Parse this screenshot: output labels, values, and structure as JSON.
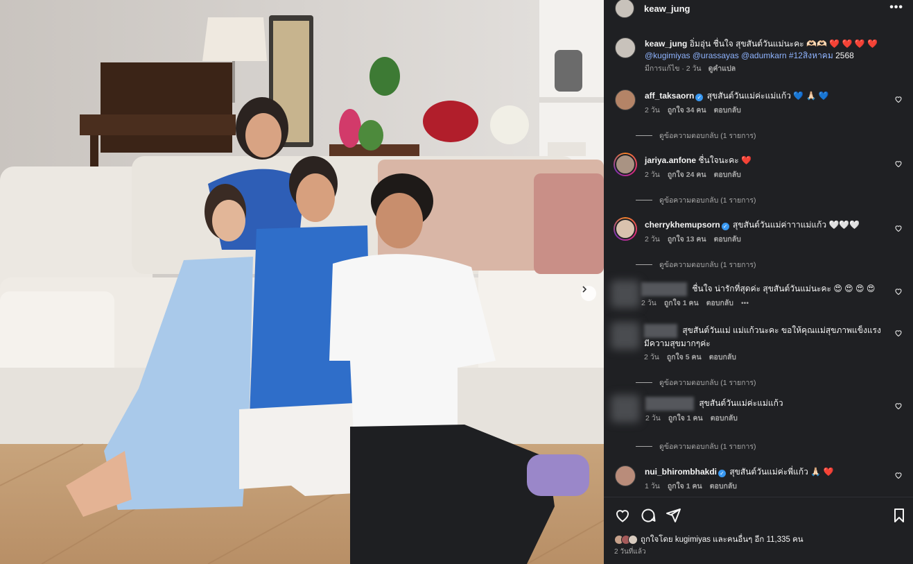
{
  "post": {
    "username": "keaw_jung"
  },
  "caption": {
    "username": "keaw_jung",
    "text": "อิ่มอุ่น ชื่นใจ สุขสันต์วันแม่นะคะ 🫶🏻🫶🏻",
    "hearts": "❤️ ❤️ ❤️ ❤️",
    "mentions": "@kugimiyas @urassayas @adumkarn #12สิงหาคม",
    "year": "2568",
    "edited": "มีการแก้ไข · 2 วัน",
    "translate": "ดูคำแปล"
  },
  "comments": [
    {
      "username": "aff_taksaorn",
      "verified": true,
      "text": "สุขสันต์วันแม่ค่ะแม่แก้ว",
      "emoji": "💙 🙏🏻 💙",
      "time": "2 วัน",
      "likes": "ถูกใจ 34 คน",
      "reply": "ตอบกลับ",
      "replies": "ดูข้อความตอบกลับ (1 รายการ)"
    },
    {
      "username": "jariya.anfone",
      "verified": false,
      "text": "ชื่นใจนะคะ",
      "emoji": "❤️",
      "time": "2 วัน",
      "likes": "ถูกใจ 24 คน",
      "reply": "ตอบกลับ",
      "replies": "ดูข้อความตอบกลับ (1 รายการ)"
    },
    {
      "username": "cherrykhemupsorn",
      "verified": true,
      "text": "สุขสันต์วันแม่ค่าาาแม่แก้ว",
      "emoji": "🤍🤍🤍",
      "time": "2 วัน",
      "likes": "ถูกใจ 13 คน",
      "reply": "ตอบกลับ",
      "replies": "ดูข้อความตอบกลับ (1 รายการ)"
    },
    {
      "username": "",
      "verified": false,
      "text": "ชื่นใจ น่ารักที่สุดค่ะ สุขสันต์วันแม่นะคะ",
      "emoji": "😍 😍 😍 😍",
      "time": "2 วัน",
      "likes": "ถูกใจ 1 คน",
      "reply": "ตอบกลับ",
      "more": "•••"
    },
    {
      "username": "",
      "verified": false,
      "text": "สุขสันต์วันแม่ แม่แก้วนะคะ ขอให้คุณแม่สุขภาพแข็งแรง มีความสุขมากๆค่ะ",
      "emoji": "",
      "time": "2 วัน",
      "likes": "ถูกใจ 5 คน",
      "reply": "ตอบกลับ",
      "replies": "ดูข้อความตอบกลับ (1 รายการ)"
    },
    {
      "username": "",
      "verified": false,
      "text": "สุขสันต์วันแม่ค่ะแม่แก้ว",
      "emoji": "",
      "time": "2 วัน",
      "likes": "ถูกใจ 1 คน",
      "reply": "ตอบกลับ",
      "replies": "ดูข้อความตอบกลับ (1 รายการ)"
    },
    {
      "username": "nui_bhirombhakdi",
      "verified": true,
      "text": "สุขสันต์วันแม่ค่ะพี่แก้ว",
      "emoji": "🙏🏻 ❤️",
      "time": "1 วัน",
      "likes": "ถูกใจ 1 คน",
      "reply": "ตอบกลับ"
    }
  ],
  "footer": {
    "liked_by": "ถูกใจโดย kugimiyas และคนอื่นๆ อีก 11,335 คน",
    "posted": "2 วันที่แล้ว"
  },
  "icons": {
    "like": "heart-icon",
    "comment": "comment-icon",
    "share": "share-icon",
    "save": "bookmark-icon",
    "next": "chevron-right-icon",
    "more": "more-icon"
  },
  "colors": {
    "panel_bg": "#1f2023",
    "link": "#8fb4ff",
    "muted": "#a8a8a8",
    "verified": "#3897f0"
  }
}
